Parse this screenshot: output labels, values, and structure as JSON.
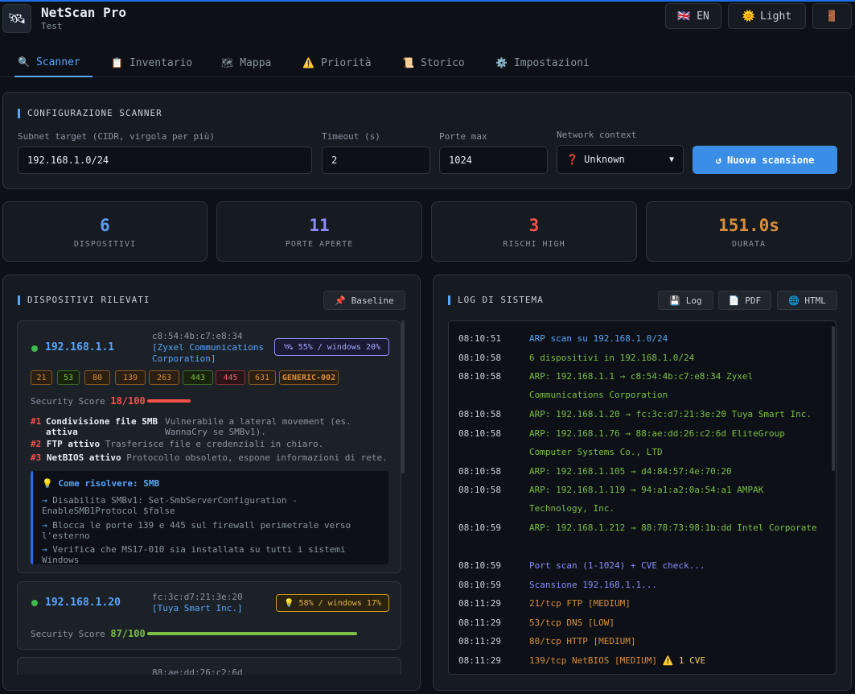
{
  "header": {
    "logo_icon": "🛰",
    "title": "NetScan Pro",
    "subtitle": "Test",
    "lang_button": "🇬🇧 EN",
    "theme_icon": "🌞",
    "theme_button": "Light",
    "exit_icon": "🚪"
  },
  "tabs": [
    {
      "icon": "🔍",
      "label": "Scanner"
    },
    {
      "icon": "📋",
      "label": "Inventario"
    },
    {
      "icon": "🗺",
      "label": "Mappa"
    },
    {
      "icon": "⚠️",
      "label": "Priorità"
    },
    {
      "icon": "📜",
      "label": "Storico"
    },
    {
      "icon": "⚙️",
      "label": "Impostazioni"
    }
  ],
  "config": {
    "title": "CONFIGURAZIONE SCANNER",
    "subnet_label": "Subnet target (CIDR, virgola per più)",
    "subnet_value": "192.168.1.0/24",
    "timeout_label": "Timeout (s)",
    "timeout_value": "2",
    "ports_label": "Porte max",
    "ports_value": "1024",
    "context_label": "Network context",
    "context_value": "❓ Unknown",
    "scan_button": "↺ Nuova scansione"
  },
  "stats": [
    {
      "value": "6",
      "caption": "DISPOSITIVI",
      "color": "#5b9cf5"
    },
    {
      "value": "11",
      "caption": "PORTE APERTE",
      "color": "#8c8cff"
    },
    {
      "value": "3",
      "caption": "RISCHI HIGH",
      "color": "#f85149"
    },
    {
      "value": "151.0s",
      "caption": "DURATA",
      "color": "#db8e3a"
    }
  ],
  "devices": {
    "title": "DISPOSITIVI RILEVATI",
    "baseline_button": "📌 Baseline",
    "cards": [
      {
        "ip": "192.168.1.1",
        "mac": "c8:54:4b:c7:e8:34",
        "vendor": "[Zyxel Communications Corporation]",
        "os_badge": "🛰 55% / windows 20%",
        "ports": [
          "21",
          "53",
          "80",
          "139",
          "263",
          "443",
          "445",
          "631",
          "GENERIC-002"
        ],
        "score_label": "Security Score",
        "score": "18/100",
        "score_value": 18,
        "risks": [
          {
            "num": "#1",
            "title": "Condivisione file SMB attiva",
            "desc": "Vulnerabile a lateral movement (es. WannaCry se SMBv1)."
          },
          {
            "num": "#2",
            "title": "FTP attivo",
            "desc": "Trasferisce file e credenziali in chiaro."
          },
          {
            "num": "#3",
            "title": "NetBIOS attivo",
            "desc": "Protocollo obsoleto, espone informazioni di rete."
          }
        ],
        "fix_title": "💡 Come risolvere: SMB",
        "fixes": [
          "Disabilita SMBv1: Set-SmbServerConfiguration -EnableSMB1Protocol $false",
          "Blocca le porte 139 e 445 sul firewall perimetrale verso l'esterno",
          "Verifica che MS17-010 sia installata su tutti i sistemi Windows"
        ]
      },
      {
        "ip": "192.168.1.20",
        "mac": "fc:3c:d7:21:3e:20",
        "vendor": "[Tuya Smart Inc.]",
        "os_badge": "💡 58% / windows 17%",
        "score_label": "Security Score",
        "score": "87/100",
        "score_value": 87
      },
      {
        "mac": "88:ae:dd:26:c2:6d"
      }
    ]
  },
  "log": {
    "title": "LOG DI SISTEMA",
    "buttons": [
      "💾 Log",
      "📄 PDF",
      "🌐 HTML"
    ],
    "entries": [
      {
        "time": "08:10:51",
        "msg": "ARP scan su 192.168.1.0/24",
        "color": "blue"
      },
      {
        "time": "08:10:58",
        "msg": "6 dispositivi in 192.168.1.0/24",
        "color": "green"
      },
      {
        "time": "08:10:58",
        "msg": "ARP: 192.168.1.1 → c8:54:4b:c7:e8:34 Zyxel Communications Corporation",
        "color": "green"
      },
      {
        "time": "08:10:58",
        "msg": "ARP: 192.168.1.20 → fc:3c:d7:21:3e:20 Tuya Smart Inc.",
        "color": "green"
      },
      {
        "time": "08:10:58",
        "msg": "ARP: 192.168.1.76 → 88:ae:dd:26:c2:6d EliteGroup Computer Systems Co., LTD",
        "color": "green"
      },
      {
        "time": "08:10:58",
        "msg": "ARP: 192.168.1.105 → d4:84:57:4e:70:20",
        "color": "green"
      },
      {
        "time": "08:10:58",
        "msg": "ARP: 192.168.1.119 → 94:a1:a2:0a:54:a1 AMPAK Technology, Inc.",
        "color": "green"
      },
      {
        "time": "08:10:59",
        "msg": "ARP: 192.168.1.212 → 88:78:73:98:1b:dd Intel Corporate",
        "color": "green"
      },
      {
        "time": "08:10:59",
        "msg": "Port scan (1-1024) + CVE check...",
        "color": "purple"
      },
      {
        "time": "08:10:59",
        "msg": "Scansione 192.168.1.1...",
        "color": "purple"
      },
      {
        "time": "08:11:29",
        "msg": "21/tcp FTP [MEDIUM]",
        "color": "orange"
      },
      {
        "time": "08:11:29",
        "msg": "53/tcp DNS [LOW]",
        "color": "orange"
      },
      {
        "time": "08:11:29",
        "msg": "80/tcp HTTP [MEDIUM]",
        "color": "orange"
      },
      {
        "time": "08:11:29",
        "msg": "139/tcp NetBIOS [MEDIUM]",
        "color": "orange",
        "cve": "⚠️ 1 CVE"
      }
    ]
  },
  "colors": {
    "accent": "#58a6ff",
    "primary_button": "#3b8ee6",
    "score_bad": "#f85149",
    "score_good": "#7bc043"
  }
}
